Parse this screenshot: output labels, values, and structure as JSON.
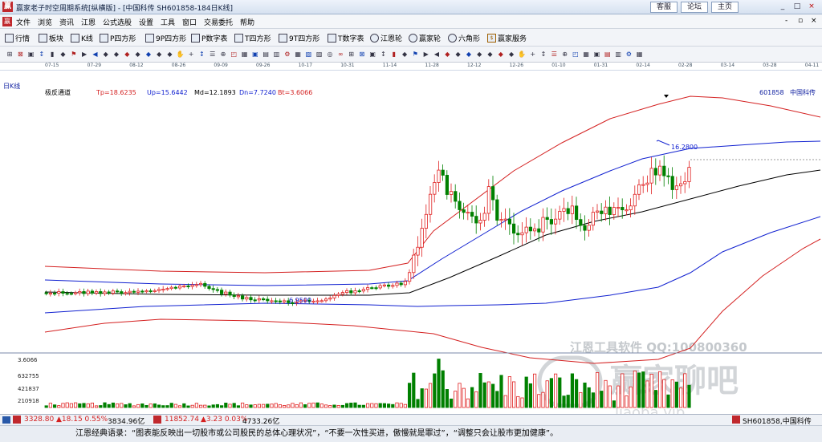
{
  "window": {
    "logo": "赢",
    "title": "赢家老子时空周期系统[纵横版] - [中国科传  SH601858-184日K线]",
    "top_buttons": [
      "客服",
      "论坛",
      "主页"
    ],
    "controls": [
      "_",
      "□",
      "×"
    ],
    "inner_controls": [
      "-",
      "▫",
      "×"
    ]
  },
  "menu": [
    "文件",
    "浏览",
    "资讯",
    "江恩",
    "公式选股",
    "设置",
    "工具",
    "窗口",
    "交易委托",
    "帮助"
  ],
  "toolbar1": [
    {
      "label": "行情",
      "icon": "grid-icon"
    },
    {
      "label": "板块",
      "icon": "blocks-icon"
    },
    {
      "label": "K线",
      "icon": "kline-icon"
    },
    {
      "label": "P四方形",
      "icon": "p-icon"
    },
    {
      "label": "9P四方形",
      "icon": "9p-icon"
    },
    {
      "label": "P数字表",
      "icon": "pn-icon"
    },
    {
      "label": "T四方形",
      "icon": "t-icon"
    },
    {
      "label": "9T四方形",
      "icon": "9t-icon"
    },
    {
      "label": "T数字表",
      "icon": "tn-icon"
    },
    {
      "label": "江恩轮",
      "icon": "wheel-icon"
    },
    {
      "label": "赢家轮",
      "icon": "wheel-icon"
    },
    {
      "label": "六角形",
      "icon": "hexagon-icon"
    },
    {
      "label": "赢家服务",
      "icon": "dollar-icon"
    }
  ],
  "toolbar2_count": 60,
  "chart_header": {
    "period": "日K线",
    "indicator": "极反通道",
    "params": [
      "Tp=18.6235",
      "Up=15.6442",
      "Md=12.1893",
      "Dn=7.7240",
      "Bt=3.6066"
    ],
    "code": "601858",
    "name": "中国科传"
  },
  "time_axis": [
    "07-15",
    "07-29",
    "08-12",
    "08-26",
    "09-09",
    "09-26",
    "10-17",
    "10-31",
    "11-14",
    "11-28",
    "12-12",
    "12-26",
    "01-10",
    "01-31",
    "02-14",
    "02-28",
    "03-14",
    "03-28",
    "04-11"
  ],
  "annotations": {
    "high": "16.2800",
    "low": "6.9500"
  },
  "volume_axis": [
    "3.6066",
    "632755",
    "421837",
    "210918"
  ],
  "watermark": {
    "line1": "江恩工具软件  QQ:100800360",
    "line2": "赢家聊吧",
    "line3": "ljaoba.vip"
  },
  "status": {
    "index1_value": "3328.80",
    "index1_change": "▲18.15 0.55%",
    "index1_amount": "3834.96亿",
    "index2_value": "11852.74",
    "index2_change": "▲3.23 0.03%",
    "index2_amount": "4733.26亿",
    "right": "SH601858,中国科传"
  },
  "quote": "江恩经典语录：“图表能反映出一切股市或公司股民的总体心理状况”，“不要一次性买进，傲慢就是罪过”，“调整只会让股市更加健康”。",
  "colors": {
    "up": "#e02020",
    "down": "#008000",
    "upper_channel": "#d42020",
    "mid_channel": "#1020d0",
    "center": "#000000"
  }
}
